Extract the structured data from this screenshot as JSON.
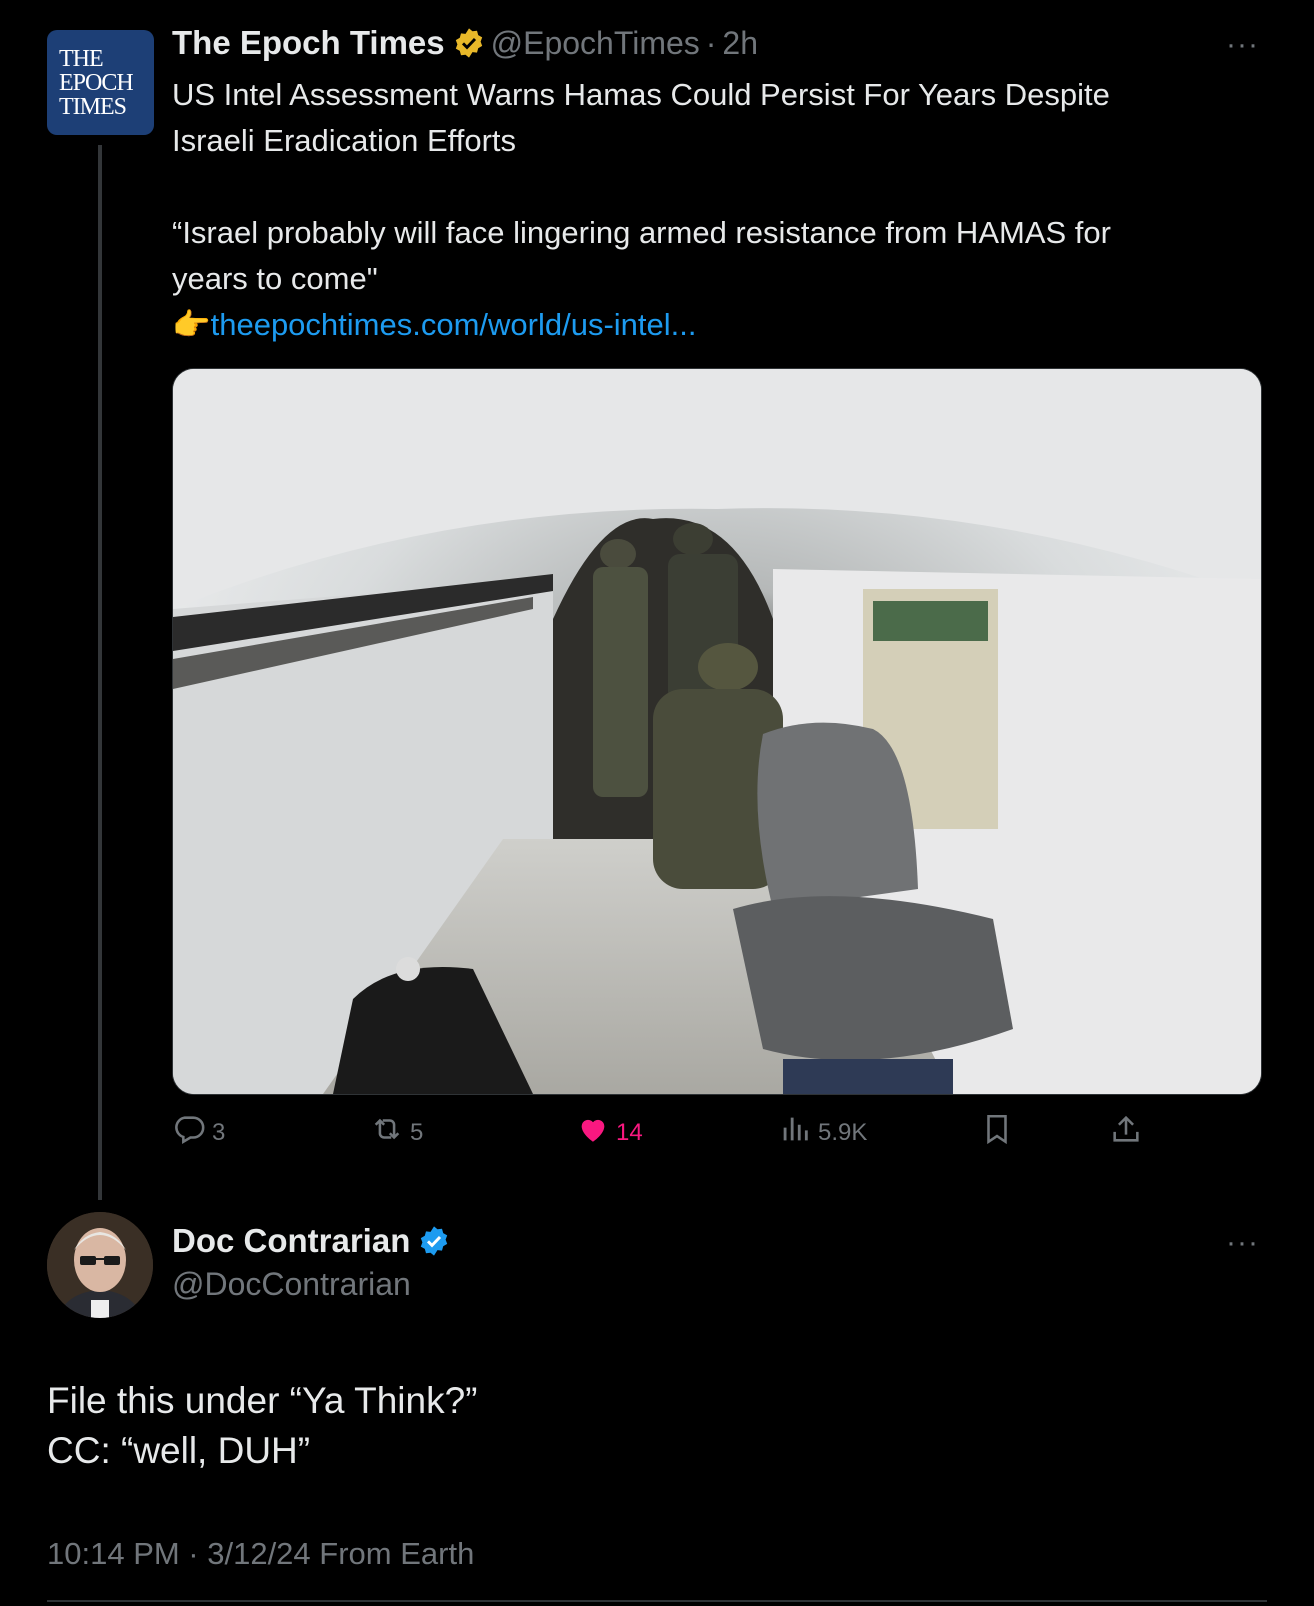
{
  "tweet1": {
    "avatar_text": [
      "THE",
      "EPOCH",
      "TIMES"
    ],
    "name": "The Epoch Times",
    "handle": "@EpochTimes",
    "sep": "·",
    "time": "2h",
    "more": "···",
    "line1": "US Intel Assessment Warns Hamas Could Persist For Years Despite",
    "line2": "Israeli Eradication Efforts",
    "quote1": "“Israel probably will face lingering armed resistance from HAMAS for",
    "quote2": "years to come\"",
    "pointer": "👉",
    "link": "theepochtimes.com/world/us-intel...",
    "actions": {
      "replies": "3",
      "reposts": "5",
      "likes": "14",
      "views": "5.9K"
    },
    "colors": {
      "verified_gold": "#e8b829",
      "like_pink": "#f91880",
      "link_blue": "#1d9bf0"
    }
  },
  "tweet2": {
    "name": "Doc Contrarian",
    "handle": "@DocContrarian",
    "more": "···",
    "line1": "File this under “Ya Think?”",
    "line2": "CC: “well, DUH”",
    "meta": "10:14 PM · 3/12/24 From Earth",
    "colors": {
      "verified_blue": "#1d9bf0"
    }
  }
}
